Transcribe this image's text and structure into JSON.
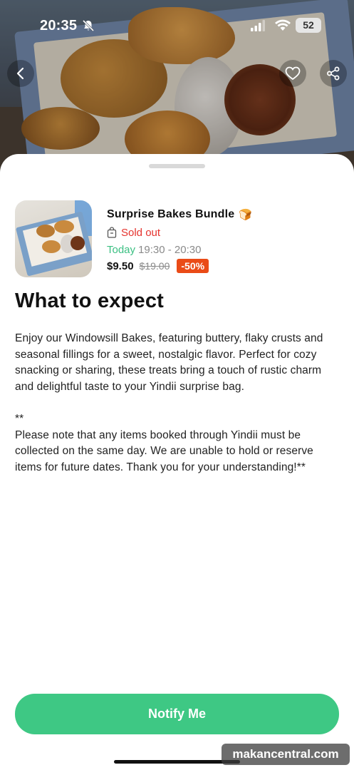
{
  "status_bar": {
    "time": "20:35",
    "battery": "52"
  },
  "product": {
    "name": "Surprise Bakes Bundle",
    "emoji": "🍞",
    "stock_status": "Sold out",
    "pickup_day": "Today",
    "pickup_window": "19:30 - 20:30",
    "price": "$9.50",
    "original_price": "$19.00",
    "discount": "-50%"
  },
  "section": {
    "title": "What to expect",
    "paragraph_1": "Enjoy our Windowsill Bakes, featuring buttery, flaky crusts and seasonal fillings for a sweet, nostalgic flavor. Perfect for cozy snacking or sharing, these treats bring a touch of rustic charm and delightful taste to your Yindii surprise bag.",
    "paragraph_2": "**\nPlease note that any items booked through Yindii must be collected on the same day. We are unable to hold or reserve items for future dates. Thank you for your understanding!**"
  },
  "actions": {
    "notify_label": "Notify Me"
  },
  "watermark": "makancentral.com",
  "icons": {
    "back": "chevron-left-icon",
    "favorite": "heart-icon",
    "share": "share-icon",
    "bag": "shopping-bag-icon",
    "bell": "bell-slash-icon"
  },
  "colors": {
    "accent_green": "#3ec884",
    "sold_out_red": "#e5322d",
    "discount_orange": "#ea4b17"
  }
}
